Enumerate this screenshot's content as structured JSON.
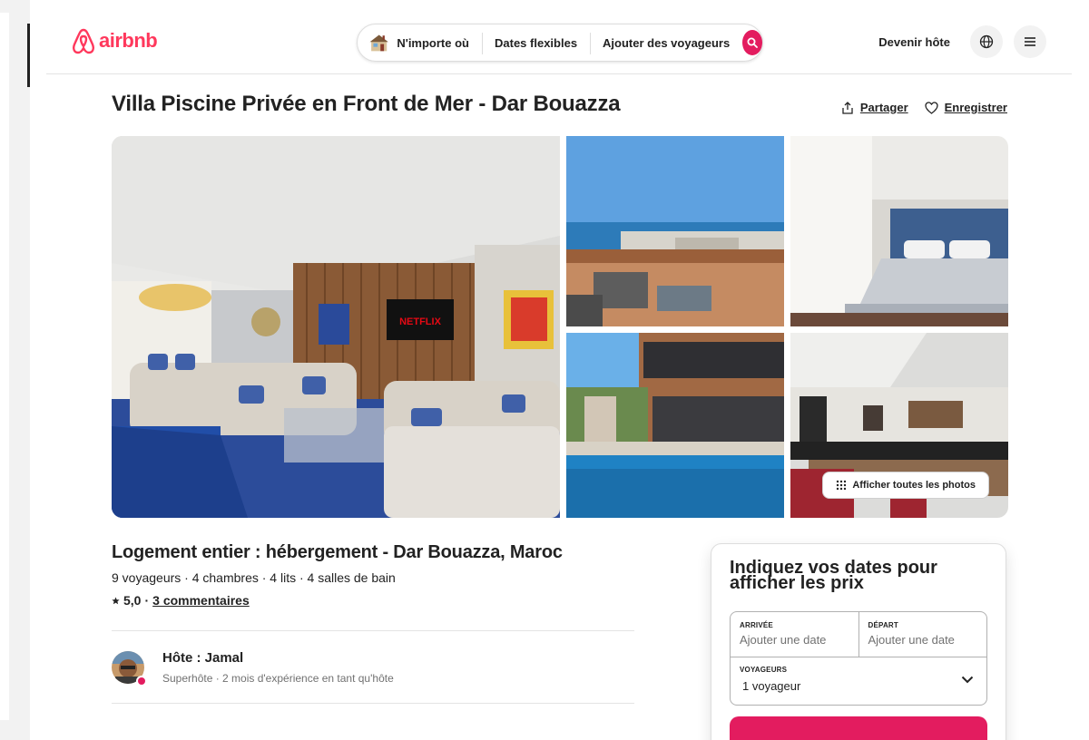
{
  "header": {
    "logo_text": "airbnb",
    "search": {
      "where": "N'importe où",
      "when": "Dates flexibles",
      "who": "Ajouter des voyageurs"
    },
    "host_link": "Devenir hôte",
    "icons": [
      "airbnb-logo-icon",
      "house-icon",
      "search-icon",
      "globe-icon",
      "menu-icon"
    ]
  },
  "listing": {
    "title": "Villa Piscine Privée en Front de Mer - Dar Bouazza",
    "share_label": "Partager",
    "save_label": "Enregistrer",
    "show_all_photos": "Afficher toutes les photos",
    "subtitle": "Logement entier : hébergement - Dar Bouazza, Maroc",
    "facts": "9 voyageurs · 4 chambres · 4 lits · 4 salles de bain",
    "rating": "5,0",
    "separator": "·",
    "reviews_link": "3 commentaires",
    "host": {
      "name": "Hôte : Jamal",
      "subtitle": "Superhôte · 2 mois d'expérience en tant qu'hôte"
    }
  },
  "booking": {
    "heading": "Indiquez vos dates pour afficher les prix",
    "checkin_label": "ARRIVÉE",
    "checkin_value": "Ajouter une date",
    "checkout_label": "DÉPART",
    "checkout_value": "Ajouter une date",
    "guests_label": "VOYAGEURS",
    "guests_value": "1 voyageur"
  },
  "colors": {
    "brand": "#ff385c",
    "search_button": "#e31c5f",
    "text": "#222222",
    "muted": "#717171"
  }
}
